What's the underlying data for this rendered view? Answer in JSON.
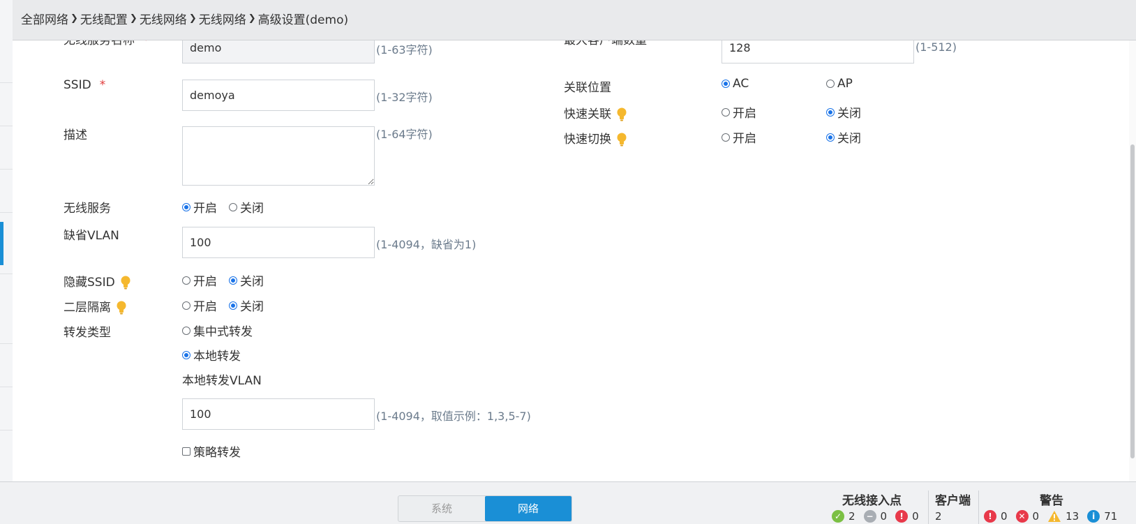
{
  "breadcrumb": [
    "全部网络",
    "无线配置",
    "无线网络",
    "无线网络",
    "高级设置(demo)"
  ],
  "form": {
    "service_name": {
      "label": "无线服务名称",
      "value": "demo",
      "hint": "(1-63字符)"
    },
    "ssid": {
      "label": "SSID",
      "value": "demoya",
      "hint": "(1-32字符)"
    },
    "description": {
      "label": "描述",
      "value": "",
      "hint": "(1-64字符)"
    },
    "wireless_service": {
      "label": "无线服务",
      "on": "开启",
      "off": "关闭",
      "selected": "on"
    },
    "default_vlan": {
      "label": "缺省VLAN",
      "value": "100",
      "hint": "(1-4094，缺省为1)"
    },
    "hide_ssid": {
      "label": "隐藏SSID",
      "on": "开启",
      "off": "关闭",
      "selected": "off"
    },
    "l2_isolation": {
      "label": "二层隔离",
      "on": "开启",
      "off": "关闭",
      "selected": "off"
    },
    "forward_type": {
      "label": "转发类型",
      "centralized": "集中式转发",
      "local": "本地转发",
      "selected": "local"
    },
    "local_vlan": {
      "label": "本地转发VLAN",
      "value": "100",
      "hint": "(1-4094，取值示例：1,3,5-7)"
    },
    "policy_forward": {
      "label": "策略转发",
      "checked": false
    },
    "max_clients": {
      "label": "最大客户端数量",
      "value": "128",
      "hint": "(1-512)"
    },
    "assoc_location": {
      "label": "关联位置",
      "ac": "AC",
      "ap": "AP",
      "selected": "ac"
    },
    "fast_assoc": {
      "label": "快速关联",
      "on": "开启",
      "off": "关闭",
      "selected": "off"
    },
    "fast_roam": {
      "label": "快速切换",
      "on": "开启",
      "off": "关闭",
      "selected": "off"
    },
    "required_mark": "*"
  },
  "footer": {
    "tabs": [
      "系统",
      "网络"
    ],
    "active_tab": "网络",
    "ap": {
      "title": "无线接入点",
      "online": "2",
      "offline": "0",
      "fault": "0"
    },
    "clients": {
      "title": "客户端",
      "count": "2"
    },
    "alerts": {
      "title": "警告",
      "critical": "0",
      "error": "0",
      "warning": "13",
      "info": "71"
    }
  },
  "colors": {
    "accent": "#1a8fd6",
    "radio_on": "#1a73e8",
    "hint": "#6b7b8c",
    "required": "#e03a3a",
    "bulb": "#f5b82e"
  }
}
